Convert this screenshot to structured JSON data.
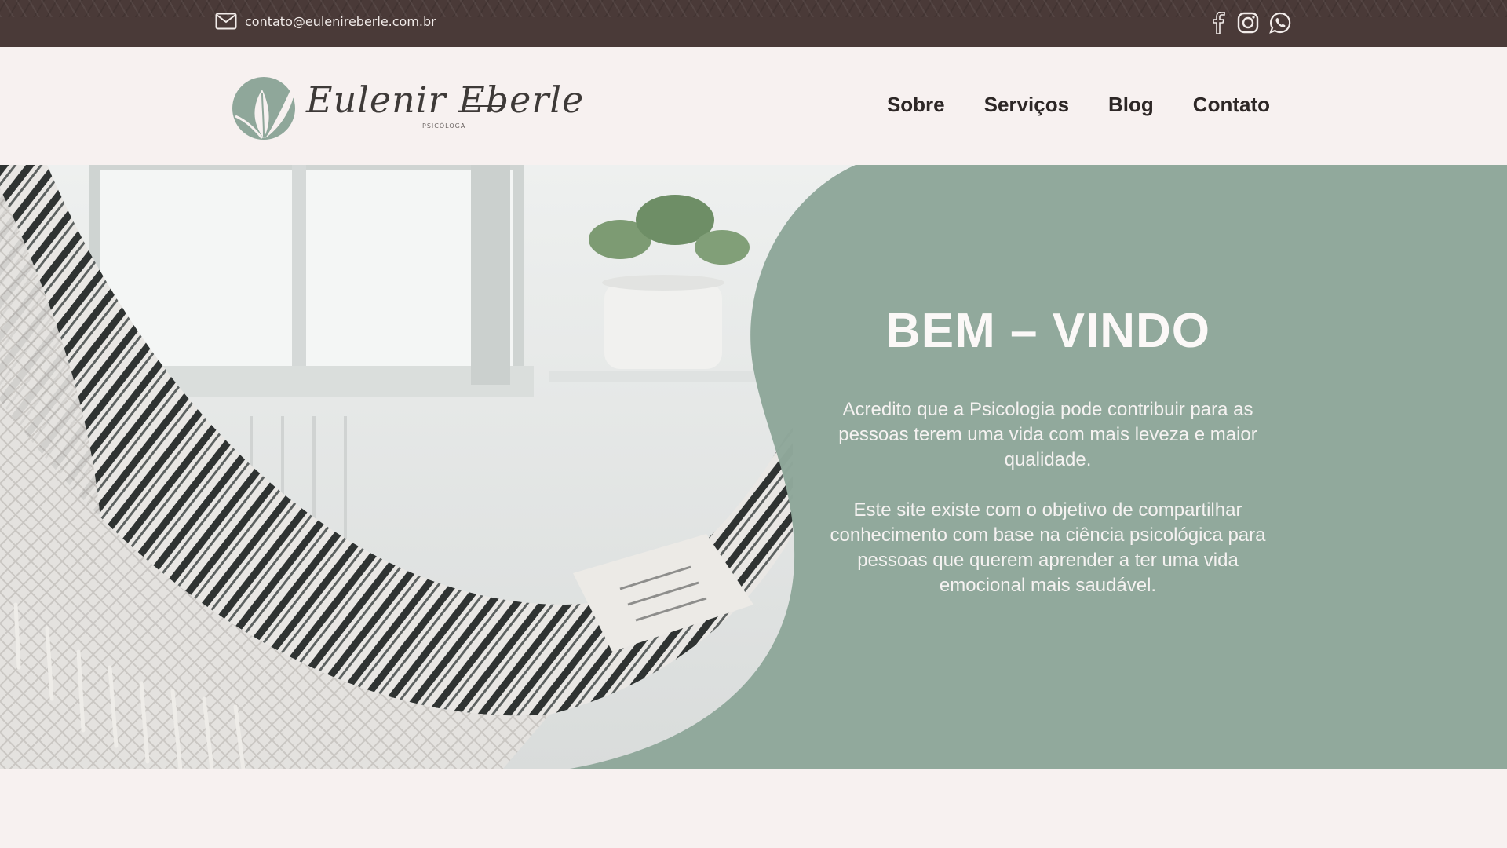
{
  "topbar": {
    "email": "contato@eulenireberle.com.br",
    "social": [
      {
        "icon": "facebook-icon"
      },
      {
        "icon": "instagram-icon"
      },
      {
        "icon": "whatsapp-icon"
      }
    ]
  },
  "header": {
    "logo": {
      "name": "Eulenir Eberle",
      "subtitle": "PSICÓLOGA"
    },
    "nav": [
      "Sobre",
      "Serviços",
      "Blog",
      "Contato"
    ]
  },
  "hero": {
    "title": "BEM – VINDO",
    "paragraph1": "Acredito que a Psicologia pode contribuir para as pessoas terem uma vida com mais leveza e maior qualidade.",
    "paragraph2": "Este site existe com o objetivo de compartilhar conhecimento com base na ciência psicológica para pessoas que querem aprender a ter uma vida emocional mais saudável.",
    "photo": "hammock-photo"
  },
  "colors": {
    "topbar": "#4a3a38",
    "background": "#f7f1f0",
    "sage": "#8fa79a",
    "nav_text": "#2d2726",
    "hero_text": "#f5f2f1"
  }
}
